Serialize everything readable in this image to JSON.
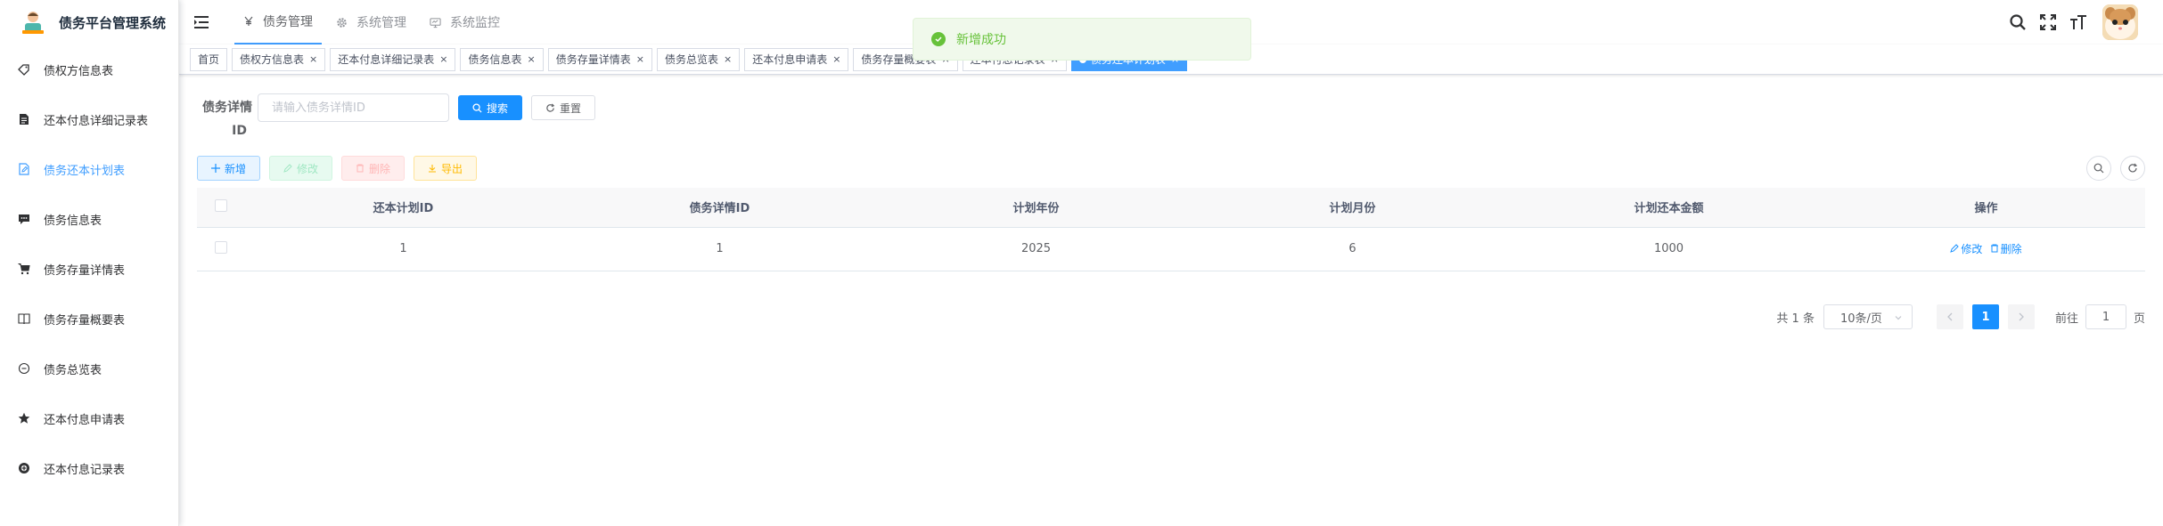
{
  "app": {
    "title": "债务平台管理系统"
  },
  "sidebar": {
    "items": [
      {
        "label": "债权方信息表",
        "icon": "tag-icon"
      },
      {
        "label": "还本付息详细记录表",
        "icon": "document-icon"
      },
      {
        "label": "债务还本计划表",
        "icon": "edit-document-icon",
        "active": true
      },
      {
        "label": "债务信息表",
        "icon": "message-icon"
      },
      {
        "label": "债务存量详情表",
        "icon": "cart-icon"
      },
      {
        "label": "债务存量概要表",
        "icon": "book-icon"
      },
      {
        "label": "债务总览表",
        "icon": "circle-minus-icon"
      },
      {
        "label": "还本付息申请表",
        "icon": "star-icon"
      },
      {
        "label": "还本付息记录表",
        "icon": "plus-circle-icon"
      }
    ]
  },
  "topnav": {
    "items": [
      {
        "label": "债务管理",
        "icon": "yen-icon",
        "active": true
      },
      {
        "label": "系统管理",
        "icon": "gear-icon"
      },
      {
        "label": "系统监控",
        "icon": "monitor-icon"
      }
    ]
  },
  "tags": {
    "items": [
      {
        "label": "首页",
        "closable": false
      },
      {
        "label": "债权方信息表",
        "closable": true
      },
      {
        "label": "还本付息详细记录表",
        "closable": true
      },
      {
        "label": "债务信息表",
        "closable": true
      },
      {
        "label": "债务存量详情表",
        "closable": true
      },
      {
        "label": "债务总览表",
        "closable": true
      },
      {
        "label": "还本付息申请表",
        "closable": true
      },
      {
        "label": "债务存量概要表",
        "closable": true
      },
      {
        "label": "还本付息记录表",
        "closable": true
      },
      {
        "label": "债务还本计划表",
        "closable": true,
        "active": true
      }
    ]
  },
  "search": {
    "label_line1": "债务详情",
    "label_line2": "ID",
    "placeholder": "请输入债务详情ID",
    "search_label": "搜索",
    "reset_label": "重置"
  },
  "toolbar": {
    "add_label": "新增",
    "edit_label": "修改",
    "delete_label": "删除",
    "export_label": "导出"
  },
  "table": {
    "columns": [
      "还本计划ID",
      "债务详情ID",
      "计划年份",
      "计划月份",
      "计划还本金额",
      "操作"
    ],
    "rows": [
      {
        "id": "1",
        "detail_id": "1",
        "year": "2025",
        "month": "6",
        "amount": "1000",
        "edit_label": "修改",
        "delete_label": "删除"
      }
    ]
  },
  "pagination": {
    "total": "共 1 条",
    "page_size": "10条/页",
    "current_page": "1",
    "goto_prefix": "前往",
    "goto_value": "1",
    "goto_suffix": "页"
  },
  "toast": {
    "message": "新增成功"
  },
  "colors": {
    "primary": "#1890ff",
    "success": "#67c23a",
    "sidebar_active": "#409eff"
  }
}
